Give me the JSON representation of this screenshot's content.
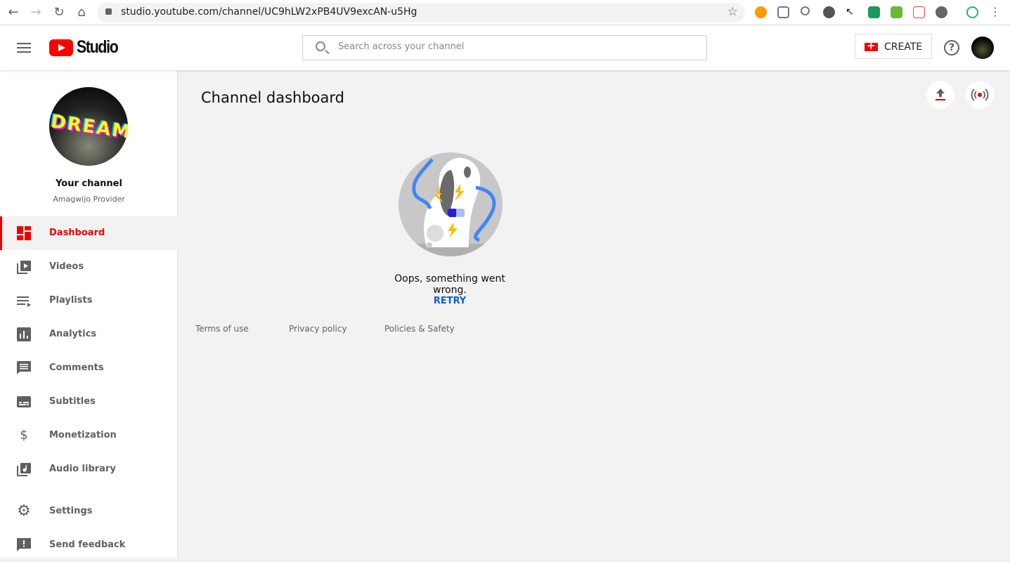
{
  "browser": {
    "url": "studio.youtube.com/channel/UC9hLW2xPB4UV9excAN-u5Hg"
  },
  "header": {
    "logo_text": "Studio",
    "search_placeholder": "Search across your channel",
    "create_label": "CREATE",
    "help": "?"
  },
  "channel": {
    "title": "Your channel",
    "name": "Amagwijo Provider",
    "avatar_text": "DREAM"
  },
  "sidebar": {
    "items": [
      {
        "label": "Dashboard",
        "icon": "dashboard-icon",
        "active": true
      },
      {
        "label": "Videos",
        "icon": "videos-icon"
      },
      {
        "label": "Playlists",
        "icon": "playlists-icon"
      },
      {
        "label": "Analytics",
        "icon": "analytics-icon"
      },
      {
        "label": "Comments",
        "icon": "comments-icon"
      },
      {
        "label": "Subtitles",
        "icon": "subtitles-icon"
      },
      {
        "label": "Monetization",
        "icon": "dollar-icon"
      },
      {
        "label": "Audio library",
        "icon": "audio-library-icon"
      },
      {
        "label": "Settings",
        "icon": "gear-icon"
      },
      {
        "label": "Send feedback",
        "icon": "feedback-icon"
      }
    ]
  },
  "main": {
    "title": "Channel dashboard",
    "error_message": "Oops, something went wrong.",
    "retry_label": "RETRY",
    "footer_links": [
      "Terms of use",
      "Privacy policy",
      "Policies & Safety"
    ]
  },
  "colors": {
    "accent": "#ff0000",
    "link": "#065fd4"
  }
}
